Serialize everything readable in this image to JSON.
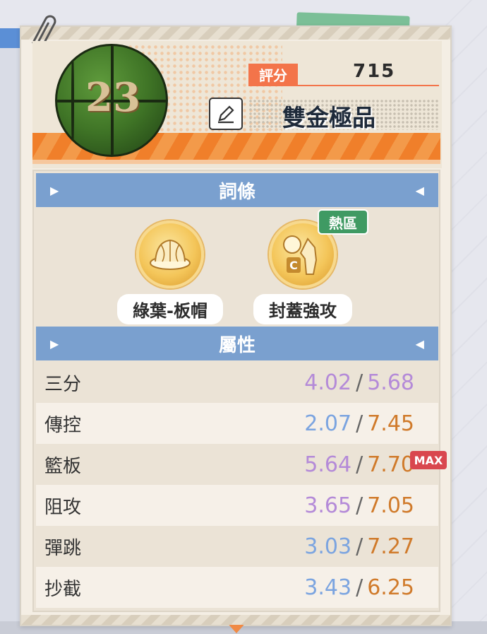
{
  "card": {
    "score_label": "評分",
    "score_value": "715",
    "item_name": "雙金極品",
    "ball_number": "23"
  },
  "perks_section": {
    "title": "詞條",
    "items": [
      {
        "label": "綠葉-板帽",
        "icon": "rebound-hat-icon"
      },
      {
        "label": "封蓋強攻",
        "icon": "block-attack-icon",
        "badge": "熱區"
      }
    ]
  },
  "attributes_section": {
    "title": "屬性",
    "rows": [
      {
        "name": "三分",
        "current": "4.02",
        "max": "5.68",
        "current_color": "#b48ad8",
        "max_color": "#b48ad8"
      },
      {
        "name": "傳控",
        "current": "2.07",
        "max": "7.45",
        "current_color": "#7ba4e0",
        "max_color": "#d07a2a"
      },
      {
        "name": "籃板",
        "current": "5.64",
        "max": "7.70",
        "current_color": "#b48ad8",
        "max_color": "#d07a2a",
        "badge": "MAX"
      },
      {
        "name": "阻攻",
        "current": "3.65",
        "max": "7.05",
        "current_color": "#b48ad8",
        "max_color": "#d07a2a"
      },
      {
        "name": "彈跳",
        "current": "3.03",
        "max": "7.27",
        "current_color": "#7ba4e0",
        "max_color": "#d07a2a"
      },
      {
        "name": "抄截",
        "current": "3.43",
        "max": "6.25",
        "current_color": "#7ba4e0",
        "max_color": "#d07a2a"
      }
    ]
  },
  "icons": {
    "edit": "pencil-edit-icon",
    "section_left": "triangle-right-icon",
    "section_right": "triangle-left-icon",
    "scroll": "scroll-down-arrow-icon"
  }
}
